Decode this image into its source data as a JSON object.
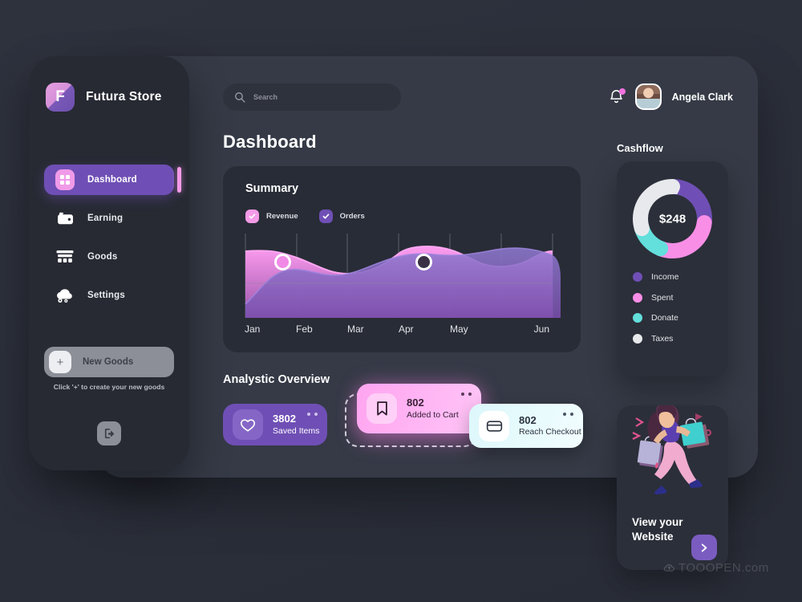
{
  "brand": {
    "name": "Futura Store",
    "logo_letter": "F",
    "logo_icon": "app-logo-icon"
  },
  "sidebar": {
    "items": [
      {
        "label": "Dashboard",
        "icon": "grid-tile-icon",
        "active": true
      },
      {
        "label": "Earning",
        "icon": "wallet-icon",
        "active": false
      },
      {
        "label": "Goods",
        "icon": "store-icon",
        "active": false
      },
      {
        "label": "Settings",
        "icon": "gear-cloud-icon",
        "active": false
      }
    ],
    "new_goods": {
      "label": "New Goods",
      "plus": "+"
    },
    "hint": "Click '+' to create your new goods",
    "logout_icon": "logout-icon"
  },
  "topbar": {
    "search_placeholder": "Search",
    "search_value": "",
    "search_icon": "search-icon",
    "bell_icon": "bell-icon",
    "user_name": "Angela Clark"
  },
  "page_title": "Dashboard",
  "summary": {
    "title": "Summary",
    "legend": [
      {
        "label": "Revenue",
        "color": "#f49ae8",
        "checked": true
      },
      {
        "label": "Orders",
        "color": "#6f4fb5",
        "checked": true
      }
    ]
  },
  "analystic": {
    "title": "Analystic Overview",
    "cards": [
      {
        "value": "3802",
        "label": "Saved Items",
        "icon": "heart-icon",
        "color": "#6f4fb5"
      },
      {
        "value": "802",
        "label": "Added to Cart",
        "icon": "bookmark-icon",
        "color": "#ffa4f0"
      },
      {
        "value": "802",
        "label": "Reach Checkout",
        "icon": "credit-card-icon",
        "color": "#dcf7fb"
      }
    ]
  },
  "cashflow": {
    "title": "Cashflow",
    "total": "$248",
    "legend": [
      {
        "label": "Income",
        "color": "#6f4fb5"
      },
      {
        "label": "Spent",
        "color": "#f98ee6"
      },
      {
        "label": "Donate",
        "color": "#63dfdc"
      },
      {
        "label": "Taxes",
        "color": "#e8e9ec"
      }
    ]
  },
  "website": {
    "title_line1": "View your",
    "title_line2": "Website",
    "go_icon": "arrow-right-icon"
  },
  "watermark": {
    "text": "TOOOPEN.com",
    "icon": "cloud-icon"
  },
  "chart_data": [
    {
      "type": "area",
      "title": "Summary",
      "categories": [
        "Jan",
        "Feb",
        "Mar",
        "Apr",
        "May",
        "Jun"
      ],
      "xlabel": "",
      "ylabel": "",
      "ylim": [
        0,
        100
      ],
      "grid": true,
      "legend_position": "top-left",
      "series": [
        {
          "name": "Revenue",
          "color": "#f49ae8",
          "values": [
            62,
            58,
            33,
            40,
            86,
            72
          ]
        },
        {
          "name": "Orders",
          "color": "#6f4fb5",
          "values": [
            5,
            40,
            38,
            62,
            66,
            80
          ]
        }
      ],
      "markers": [
        {
          "series": "Revenue",
          "x": "Feb",
          "y": 56
        },
        {
          "series": "Orders",
          "x": "Apr",
          "y": 58
        }
      ]
    },
    {
      "type": "pie",
      "title": "Cashflow",
      "center_label": "$248",
      "labels": [
        "Income",
        "Spent",
        "Donate",
        "Taxes"
      ],
      "values": [
        27,
        29,
        14,
        30
      ],
      "colors": [
        "#6f4fb5",
        "#f98ee6",
        "#63dfdc",
        "#e8e9ec"
      ],
      "legend_position": "bottom"
    }
  ]
}
